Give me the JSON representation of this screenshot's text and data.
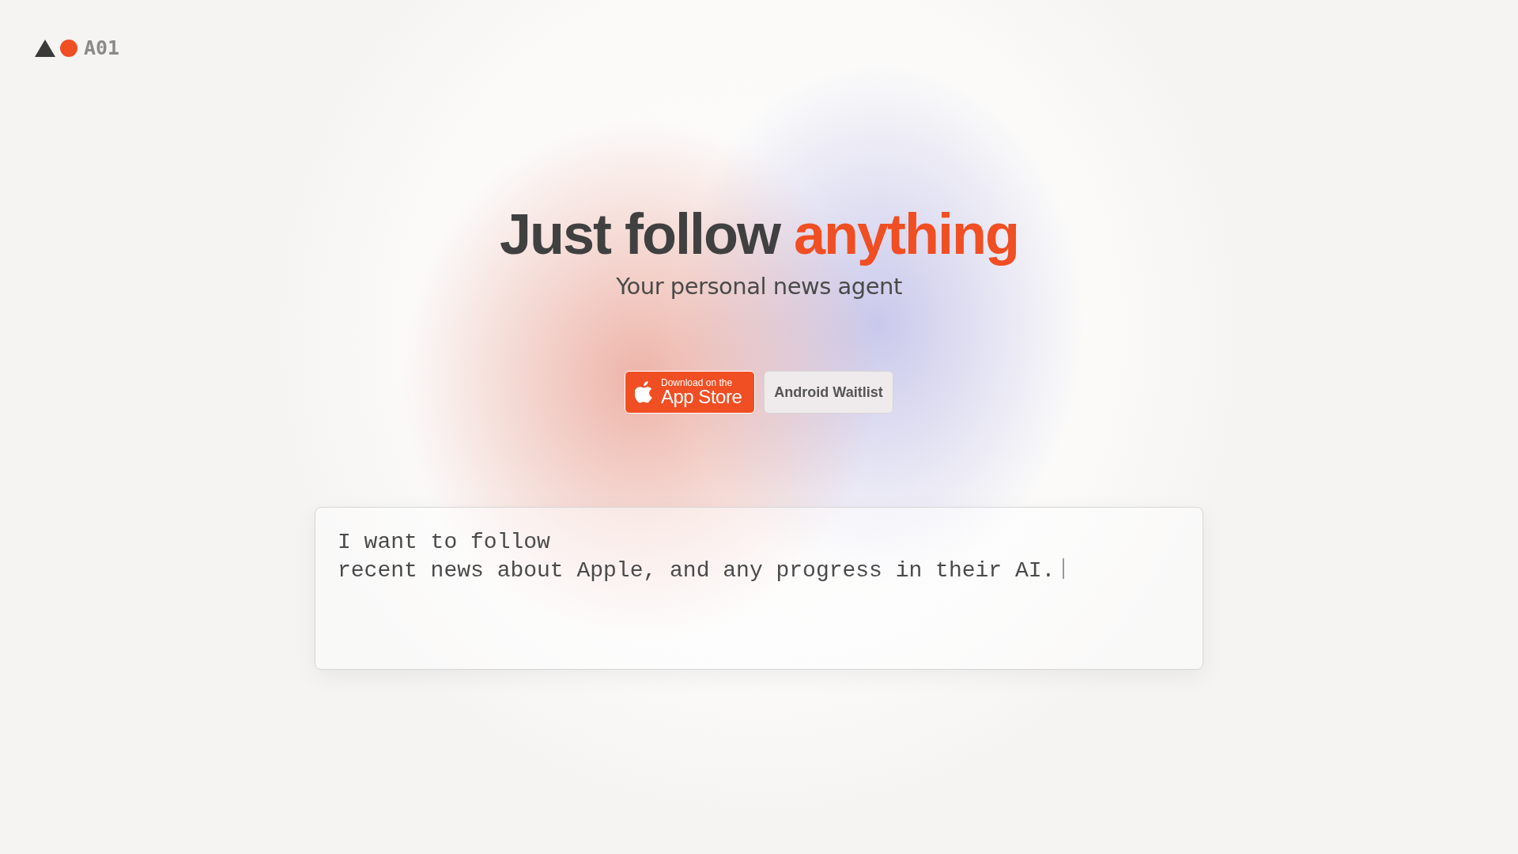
{
  "logo": {
    "text": "A01"
  },
  "hero": {
    "title": "Just follow",
    "title_highlight": "anything",
    "subtitle": "Your personal news agent"
  },
  "buttons": [
    {
      "kind": "appstore",
      "small": "Download on the",
      "label": "App Store"
    },
    {
      "kind": "plain",
      "label": "Android Waitlist"
    }
  ],
  "prompt": {
    "lines": [
      "I want to follow",
      "recent news about Apple, and any progress in their AI."
    ],
    "cursor": true
  }
}
